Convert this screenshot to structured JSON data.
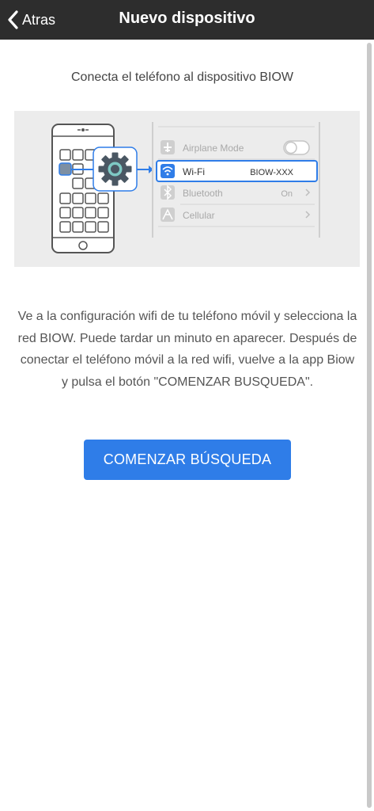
{
  "header": {
    "back_label": "Atras",
    "title": "Nuevo dispositivo"
  },
  "main": {
    "heading": "Conecta el teléfono al dispositivo BIOW",
    "description": "Ve a la configuración wifi de tu teléfono móvil y selecciona la red BIOW. Puede tardar un minuto en aparecer. Después de conectar el teléfono móvil a la red wifi, vuelve a la app Biow y pulsa el botón \"COMENZAR BUSQUEDA\".",
    "cta_label": "COMENZAR BÚSQUEDA"
  },
  "illustration": {
    "settings_rows": [
      {
        "icon": "airplane-icon",
        "label": "Airplane Mode",
        "value": ""
      },
      {
        "icon": "wifi-icon",
        "label": "Wi-Fi",
        "value": "BIOW-XXX"
      },
      {
        "icon": "bluetooth-icon",
        "label": "Bluetooth",
        "value": "On"
      },
      {
        "icon": "cellular-icon",
        "label": "Cellular",
        "value": ""
      }
    ]
  },
  "colors": {
    "header_bg": "#2d2d2d",
    "accent": "#2f7de8",
    "illustration_bg": "#ececec"
  }
}
